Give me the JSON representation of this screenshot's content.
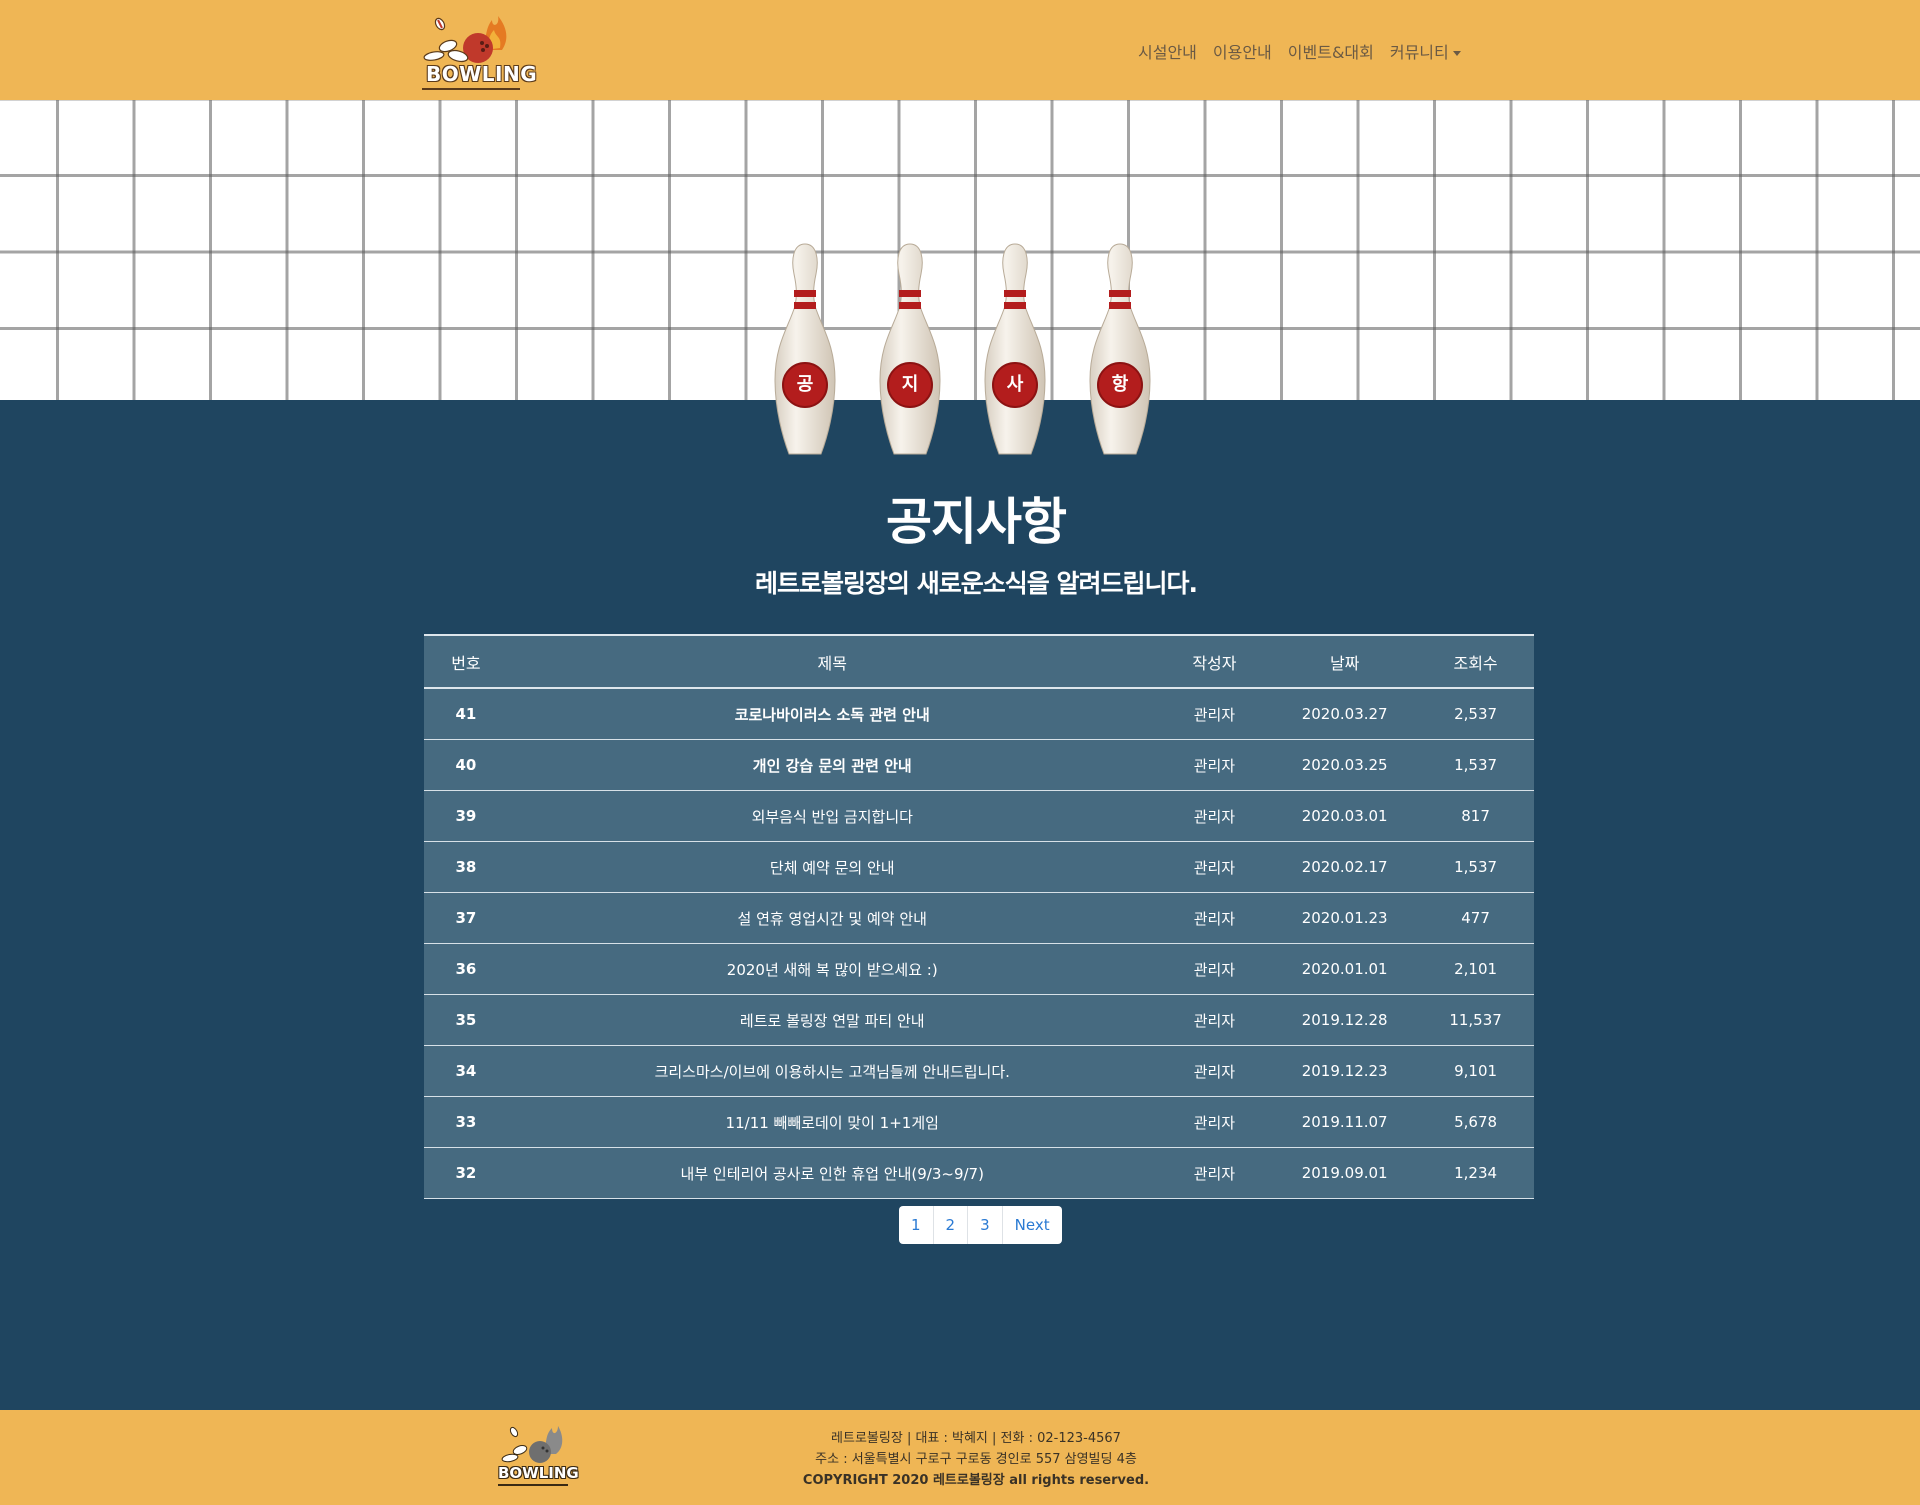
{
  "brand": {
    "logo_text": "BOWLING"
  },
  "nav": {
    "items": [
      {
        "label": "시설안내"
      },
      {
        "label": "이용안내"
      },
      {
        "label": "이벤트&대회"
      },
      {
        "label": "커뮤니티"
      }
    ]
  },
  "hero": {
    "pins": [
      "공",
      "지",
      "사",
      "항"
    ]
  },
  "main": {
    "title": "공지사항",
    "subtitle": "레트로볼링장의 새로운소식을 알려드립니다."
  },
  "table": {
    "headers": {
      "no": "번호",
      "title": "제목",
      "writer": "작성자",
      "date": "날짜",
      "views": "조회수"
    },
    "rows": [
      {
        "no": "41",
        "title": "코로나바이러스 소독 관련 안내",
        "writer": "관리자",
        "date": "2020.03.27",
        "views": "2,537"
      },
      {
        "no": "40",
        "title": "개인 강습 문의 관련 안내",
        "writer": "관리자",
        "date": "2020.03.25",
        "views": "1,537"
      },
      {
        "no": "39",
        "title": "외부음식 반입 금지합니다",
        "writer": "관리자",
        "date": "2020.03.01",
        "views": "817"
      },
      {
        "no": "38",
        "title": "단체 예약 문의 안내",
        "writer": "관리자",
        "date": "2020.02.17",
        "views": "1,537"
      },
      {
        "no": "37",
        "title": "설 연휴 영업시간 및 예약 안내",
        "writer": "관리자",
        "date": "2020.01.23",
        "views": "477"
      },
      {
        "no": "36",
        "title": "2020년 새해 복 많이 받으세요 :)",
        "writer": "관리자",
        "date": "2020.01.01",
        "views": "2,101"
      },
      {
        "no": "35",
        "title": "레트로 볼링장 연말 파티 안내",
        "writer": "관리자",
        "date": "2019.12.28",
        "views": "11,537"
      },
      {
        "no": "34",
        "title": "크리스마스/이브에 이용하시는 고객님들께 안내드립니다.",
        "writer": "관리자",
        "date": "2019.12.23",
        "views": "9,101"
      },
      {
        "no": "33",
        "title": "11/11 빼빼로데이 맞이 1+1게임",
        "writer": "관리자",
        "date": "2019.11.07",
        "views": "5,678"
      },
      {
        "no": "32",
        "title": "내부 인테리어 공사로 인한 휴업 안내(9/3~9/7)",
        "writer": "관리자",
        "date": "2019.09.01",
        "views": "1,234"
      }
    ]
  },
  "pagination": {
    "pages": [
      "1",
      "2",
      "3"
    ],
    "next_label": "Next"
  },
  "footer": {
    "logo_text": "BOWLING",
    "line1": "레트로볼링장  |  대표 : 박혜지  |  전화 : 02-123-4567",
    "line2": "주소 : 서울특별시 구로구 구로동 경인로 557 삼영빌딩 4층",
    "copyright": "COPYRIGHT 2020 레트로볼링장 all rights reserved."
  },
  "colors": {
    "header_bg": "#efb655",
    "content_bg": "#1f4560",
    "table_bg": "#466a80",
    "pin_red": "#b31d1d",
    "link_blue": "#2a7ad3"
  }
}
